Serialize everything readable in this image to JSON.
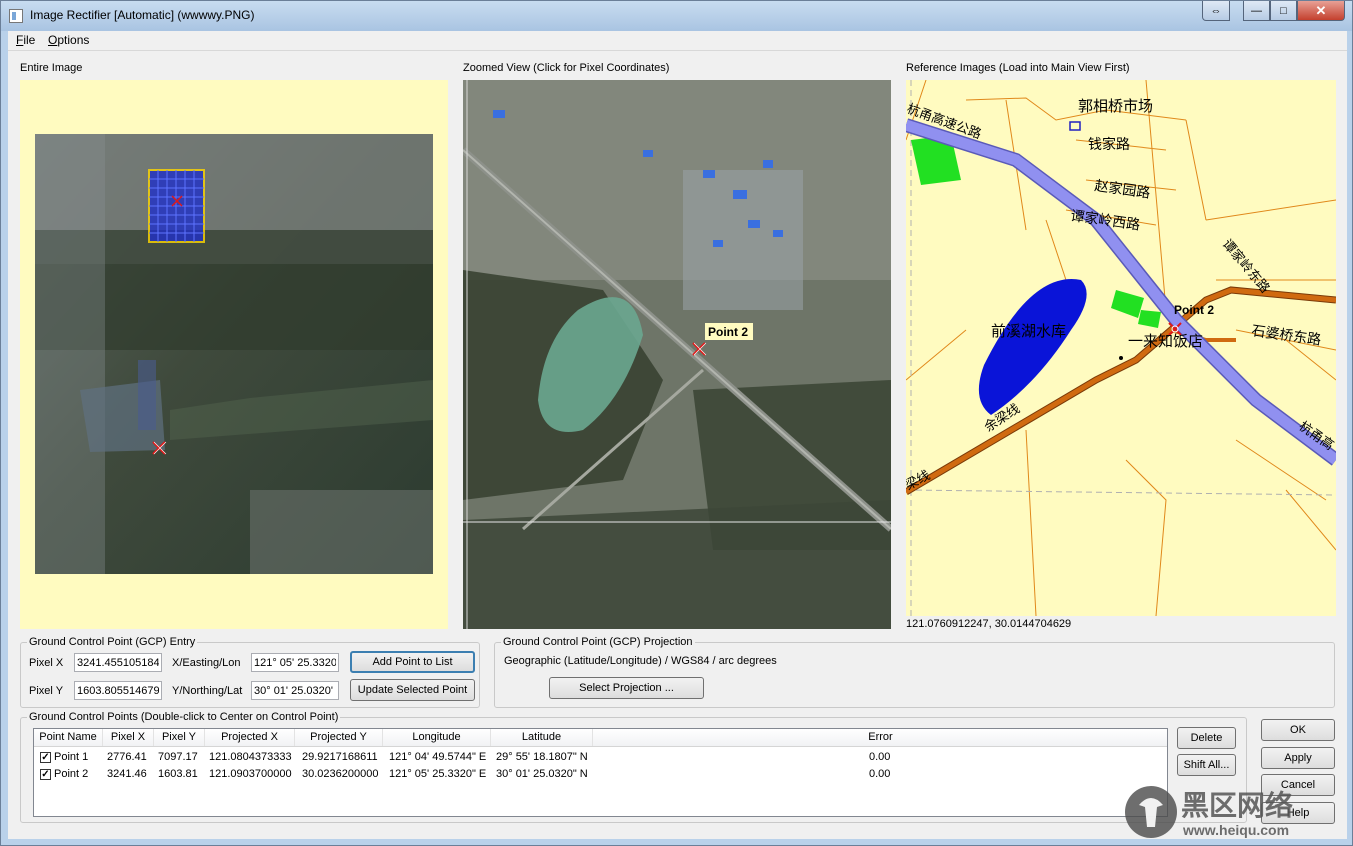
{
  "window": {
    "title": "Image Rectifier [Automatic] (wwwwy.PNG)",
    "close_glyph": "✕",
    "minimize_glyph": "—",
    "maximize_glyph": "□",
    "restore_glyph": "⇔"
  },
  "menu": {
    "file_access": "F",
    "file_rest": "ile",
    "options_access": "O",
    "options_rest": "ptions"
  },
  "panes": {
    "entire_label": "Entire Image",
    "zoomed_label": "Zoomed View (Click for Pixel Coordinates)",
    "reference_label": "Reference Images (Load into Main View First)",
    "zoom_marker_label": "Point 2",
    "ref_marker_label": "Point 2",
    "ref_coordinates": "121.0760912247, 30.0144704629",
    "map_labels": {
      "market": "郭相桥市场",
      "qianjia": "钱家路",
      "zhaojia": "赵家园路",
      "tanjia_west": "谭家岭西路",
      "highway": "杭甬高速公路",
      "highway2": "杭甬高",
      "tanjia_east": "谭家岭东路",
      "shipo": "石婆桥东路",
      "reservoir": "前溪湖水库",
      "restaurant": "一来知饭店",
      "yuliang": "余梁线",
      "liang": "梁线"
    }
  },
  "gcp_entry": {
    "group_label": "Ground Control Point (GCP) Entry",
    "pixel_x_label": "Pixel X",
    "pixel_x_value": "3241.455105184",
    "pixel_y_label": "Pixel Y",
    "pixel_y_value": "1603.805514679",
    "easting_label": "X/Easting/Lon",
    "easting_value": "121° 05' 25.3320'",
    "northing_label": "Y/Northing/Lat",
    "northing_value": "30° 01' 25.0320'",
    "add_button": "Add Point to List",
    "update_button": "Update Selected Point"
  },
  "gcp_projection": {
    "group_label": "Ground Control Point (GCP) Projection",
    "projection_text": "Geographic (Latitude/Longitude) / WGS84 / arc degrees",
    "select_button": "Select Projection ..."
  },
  "gcp_list": {
    "group_label": "Ground Control Points (Double-click to Center on Control Point)",
    "columns": [
      "Point Name",
      "Pixel X",
      "Pixel Y",
      "Projected X",
      "Projected Y",
      "Longitude",
      "Latitude",
      "Error"
    ],
    "rows": [
      {
        "checked": "✓",
        "name": "Point 1",
        "pixel_x": "2776.41",
        "pixel_y": "7097.17",
        "proj_x": "121.0804373333",
        "proj_y": "29.9217168611",
        "lon": "121° 04' 49.5744\" E",
        "lat": "29° 55' 18.1807\" N",
        "error": "0.00"
      },
      {
        "checked": "✓",
        "name": "Point 2",
        "pixel_x": "3241.46",
        "pixel_y": "1603.81",
        "proj_x": "121.0903700000",
        "proj_y": "30.0236200000",
        "lon": "121° 05' 25.3320\" E",
        "lat": "30° 01' 25.0320\" N",
        "error": "0.00"
      }
    ],
    "delete_button": "Delete",
    "shift_button": "Shift All..."
  },
  "dialog_buttons": {
    "ok": "OK",
    "apply": "Apply",
    "cancel": "Cancel",
    "help": "Help"
  },
  "watermark": {
    "brand": "黑区网络",
    "url": "www.heiqu.com"
  },
  "colors": {
    "map_background": "#fffbc0",
    "highway": "#8f8ff0",
    "water": "#0a14d8",
    "road_orange": "#d06a10",
    "marker_red": "#e01818"
  }
}
